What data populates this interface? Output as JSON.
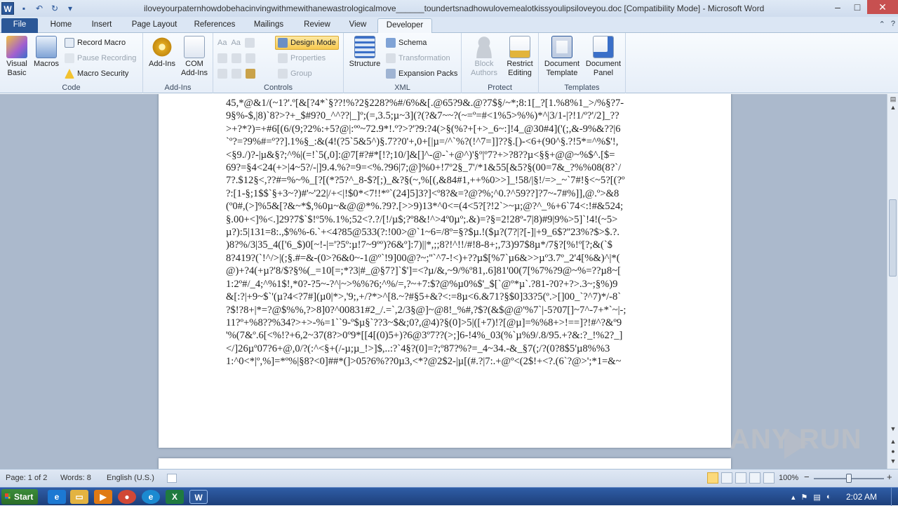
{
  "titlebar": {
    "title": "iloveyourpaternhowdobehacinvingwithmewithanewastrologicalmove______toundertsnadhowulovemealotkissyoulipsiloveyou.doc [Compatibility Mode]  -  Microsoft Word",
    "app_letter": "W",
    "minimize": "–",
    "maximize": "□",
    "close": "✕"
  },
  "tabs": [
    "File",
    "Home",
    "Insert",
    "Page Layout",
    "References",
    "Mailings",
    "Review",
    "View",
    "Developer"
  ],
  "ribbon": {
    "code": {
      "label": "Code",
      "visual_basic": "Visual Basic",
      "macros": "Macros",
      "record_macro": "Record Macro",
      "pause_recording": "Pause Recording",
      "macro_security": "Macro Security"
    },
    "addins": {
      "label": "Add-Ins",
      "addins": "Add-Ins",
      "com_addins": "COM Add-Ins"
    },
    "controls": {
      "label": "Controls",
      "design_mode": "Design Mode",
      "properties": "Properties",
      "group": "Group"
    },
    "xml": {
      "label": "XML",
      "structure": "Structure",
      "schema": "Schema",
      "transformation": "Transformation",
      "expansion_packs": "Expansion Packs"
    },
    "protect": {
      "label": "Protect",
      "block_authors": "Block Authors",
      "restrict_editing": "Restrict Editing"
    },
    "templates": {
      "label": "Templates",
      "document_template": "Document Template",
      "document_panel": "Document Panel"
    }
  },
  "document": {
    "lines": [
      "45,*@&1/(~1?'.º[&[?4*`§??!%?2§228?%#/6%&[.@65?9&.@?7$§/~*;8:1[_?[1.%8%1_>/%§?7-",
      "9§%-$,|8)`8?>?+_$#9?0_^^??|_]º;(=,3.5;µ~3](?(?&7~~?(~=º=#<1%5>%%)*^|3/1-|?!1/º?'/2]_??",
      ">+?*?)=+#6[(6/(9;?2%:+5?@|:ºº~72.9*!.º?>?'?9:?4(>§(%?+[+>_6~:]!4_@30#4]('(;,&-9%&??|6",
      "`º?=?9%#=º??].1%§_:&(4!(?5`5&5^)§.7??0'+,0+[|µ=/^`%?(!^7=]]??§.[)-<6+(90^§.?!5*=^%$'!,",
      "<§9./)?-|µ&§?;^%|(=!`5(,0]:@7[#?#*[!?;10/]&[]^-@-`+@^)'§º|º7?+>?8??µ<§§+@@~%$^.[$=",
      "69?=§4<24(+>|4~5?/-|]9.4.%?=9=<%.?96|7;@]%0+!7º2§_7'/*1&55[&5?§(00=7&_?%%08(8?`/",
      "7?.$12§<,??#=%~%_[?[(*?5?^_8-$?[;)_&?§(~,%[(,&84#1,++%0>>]_!58/|§!/=>_~`7#!§<~5?[(?º",
      "?:[1-§;1$$`§+3~?)#'~'22|/+<|!$0*<7!!*º`(24]5]3?]<º8?&=?@?%;^0.?^59??]?7~-7#%]],@.º>&8",
      "(º0#,(>]%5&[?&~*$,%0µ~&@@*%.?9?.[>>9)13*^0<=(4<5?[?!2`>~µ;@?^_%+6`74<:!#&524;",
      "§.00+<]%<.]29?7$`$!º5%.1%;52<?.?/[!/µ$;?º8&!^>4º0µº;.&)=?§=2!28º-7|8)#9|9%>5]`!4!(~5>",
      "µ?):5|131=8:.,$%%-6.`+<4?85@533(?:!00>@`1~6=/8º=§?$µ.!($µ?(7?|?[-]|+9_6$?''23%?$>$.?.",
      ")8?%/3|35_4(['6_$)0[~!-|='?5º:µ!7~9ºº)?6&º]:7)||*,;;8?!^!!/#!8-8+;,73)97$8µ*/7§?[%!º[?;&(`$",
      "8?419?(`!^/>|(;§.#=&-(0>?6&0~-1@º`!9]00@?~;''`^7-!<)+??µ$[%7`µ6&>>µº3.7º_2'4[%&)^|*(",
      "@)+?4(+µ?'8/$?§%(_=10[=;*?3|#_@§7?]`$']=<?µ/&,~9/%º81,.6]81'00(7[%7%?9@~%=??µ8~[",
      "1:2º#/_4;^%1$!,*0?-?5~-?^|~>%%?6;^%/=,?~+7:$?@%µ0%$'_$[`@º*µ`.?81-?0?+?>.3~;§%)9",
      "&[:?|+9~$`'(µ?4<?7#](µ0|*>,'9;,+/?*>^[8.~?#§5+&?<:=8µ<6.&71?§$0]33?5(º.>[]00_`?^7)*/-8`",
      "?$!?8+|*=?@$%%,?>8]0?^00831#2_/.=`,2/3§@]~@8!_%#,?$?(&$@@'%7`|-5?07[]~7^-7+*`~|-;",
      "11?º+%8??%34?>+>-%=1``9-º$µ§`??3~$&;0?,@4)?§(0]>5|([+7)!?[@µ]=%%8+>!==]?!#^?&º9",
      "'%(7&º.6[<%!?+6,2~37(8?>0º9*[[4[(0)5+)?6@3º7??(>;]6-!4%_03(%`µ%9/.8/95.+?&:?_!%2?_]",
      "</]26µº07?6+@,0/?(:^<§+(/-µ;µ_!>]$,..:?`4§?(0]=?;º87?%?=_4~34.-&_§7(;/?(0?8$5'µ8%%3",
      "1:^0<*|º,%]=*º%|§8?<0]##*(]>05?6%??0µ3,<*?@2$2-|µ[(#.?|7:.+@º<(2$!+<?.(6`?@>';*1=&~"
    ]
  },
  "statusbar": {
    "page": "Page: 1 of 2",
    "words": "Words: 8",
    "language": "English (U.S.)",
    "zoom": "100%",
    "zoom_minus": "−",
    "zoom_plus": "+"
  },
  "taskbar": {
    "start": "Start",
    "apps": [
      "ie-icon",
      "explorer-icon",
      "media-player-icon",
      "chrome-icon",
      "edge-icon",
      "excel-icon",
      "word-icon"
    ],
    "clock": "2:02 AM"
  },
  "watermark": "ANY RUN"
}
